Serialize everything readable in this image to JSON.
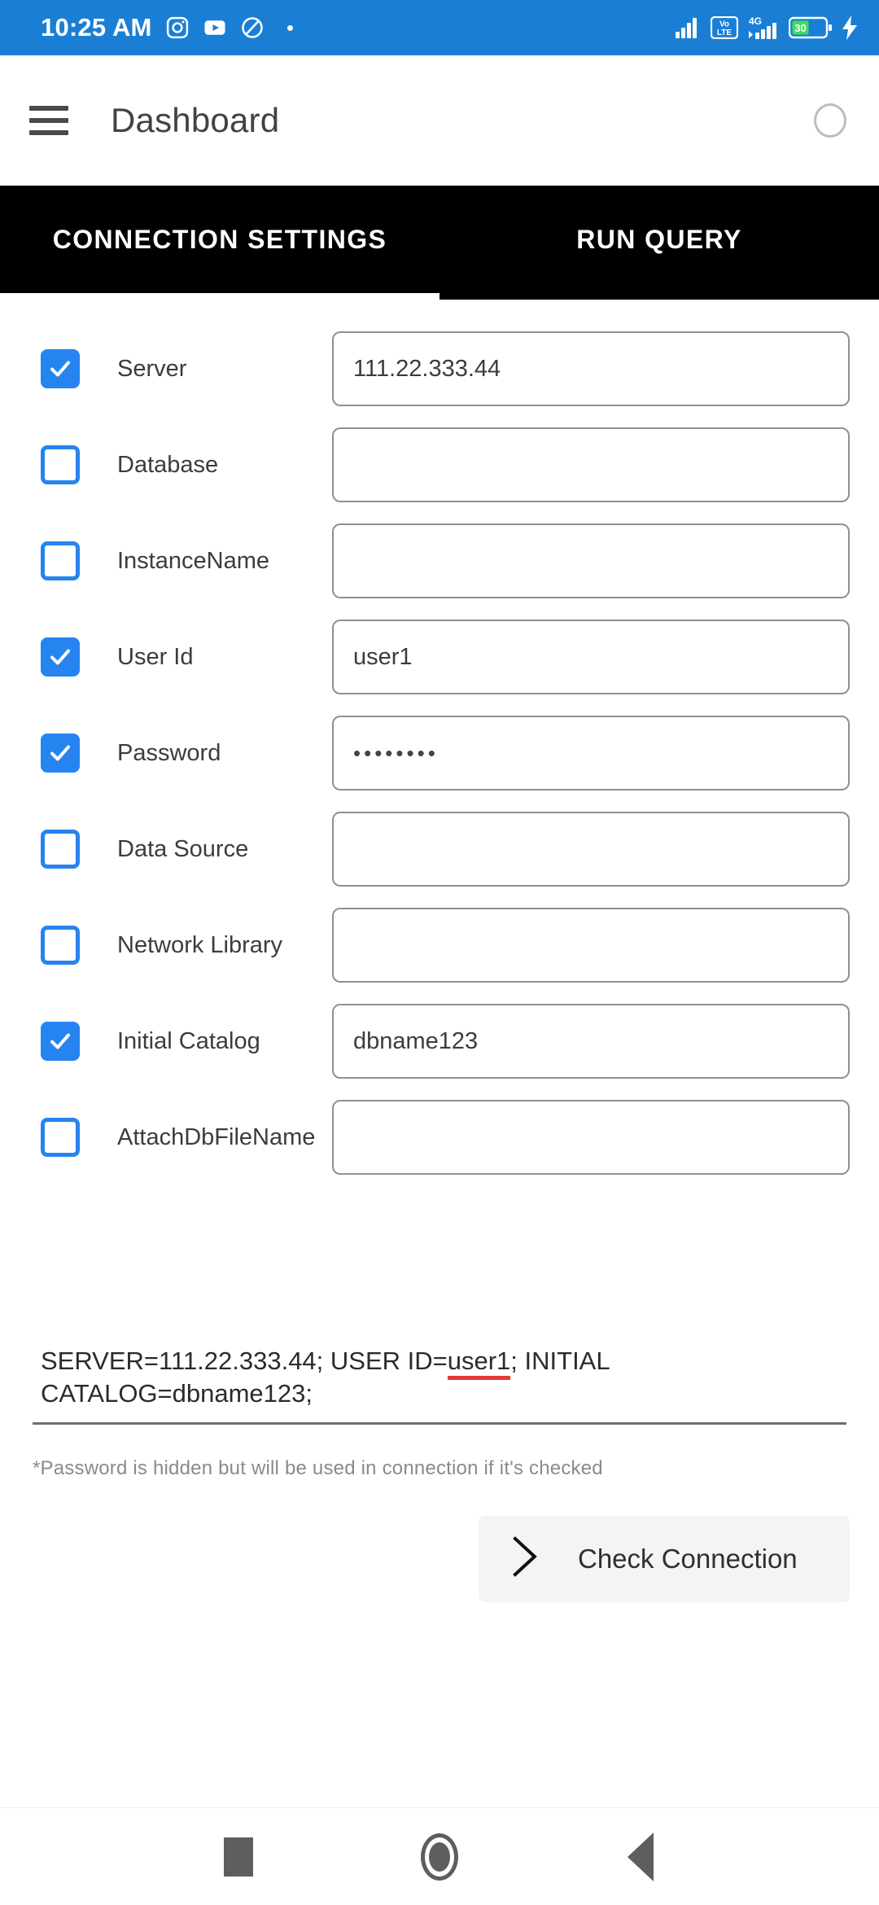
{
  "status_bar": {
    "time": "10:25 AM",
    "app_icons": [
      "instagram-icon",
      "youtube-icon",
      "circle-slash-icon"
    ],
    "notification_dot": true,
    "signal_label": "signal-bars-icon",
    "volte_top": "Vo",
    "volte_bottom": "LTE",
    "network_type": "4G",
    "battery_percent": "30",
    "charging": true,
    "background_color": "#1a7fd4"
  },
  "app_bar": {
    "menu_icon": "hamburger-menu-icon",
    "title": "Dashboard",
    "action_icon": "circle-outline-icon"
  },
  "tabs": {
    "active_index": 0,
    "items": [
      {
        "label": "CONNECTION SETTINGS"
      },
      {
        "label": "RUN QUERY"
      }
    ],
    "background_color": "#000000",
    "indicator_color": "#ffffff"
  },
  "form": {
    "checkbox_color": "#2684f0",
    "rows": [
      {
        "label": "Server",
        "checked": true,
        "value": "111.22.333.44",
        "masked": false
      },
      {
        "label": "Database",
        "checked": false,
        "value": "",
        "masked": false
      },
      {
        "label": "InstanceName",
        "checked": false,
        "value": "",
        "masked": false
      },
      {
        "label": "User Id",
        "checked": true,
        "value": "user1",
        "masked": false
      },
      {
        "label": "Password",
        "checked": true,
        "value": "••••••••",
        "masked": true
      },
      {
        "label": "Data Source",
        "checked": false,
        "value": "",
        "masked": false
      },
      {
        "label": "Network Library",
        "checked": false,
        "value": "",
        "masked": false
      },
      {
        "label": "Initial Catalog",
        "checked": true,
        "value": "dbname123",
        "masked": false
      },
      {
        "label": "AttachDbFileName",
        "checked": false,
        "value": "",
        "masked": false
      }
    ]
  },
  "connection_string": {
    "prefix": "SERVER=111.22.333.44; USER ID=",
    "misspelled": "user1",
    "suffix": "; INITIAL CATALOG=dbname123;",
    "full_text": "SERVER=111.22.333.44; USER ID=user1; INITIAL CATALOG=dbname123;",
    "spellcheck_color": "#e53935"
  },
  "note": "*Password is hidden but will be used in connection if it's checked",
  "check_connection": {
    "icon": "chevron-right-icon",
    "label": "Check Connection"
  },
  "nav_bar": {
    "recents": "square-recents-icon",
    "home": "circle-home-icon",
    "back": "triangle-back-icon"
  }
}
